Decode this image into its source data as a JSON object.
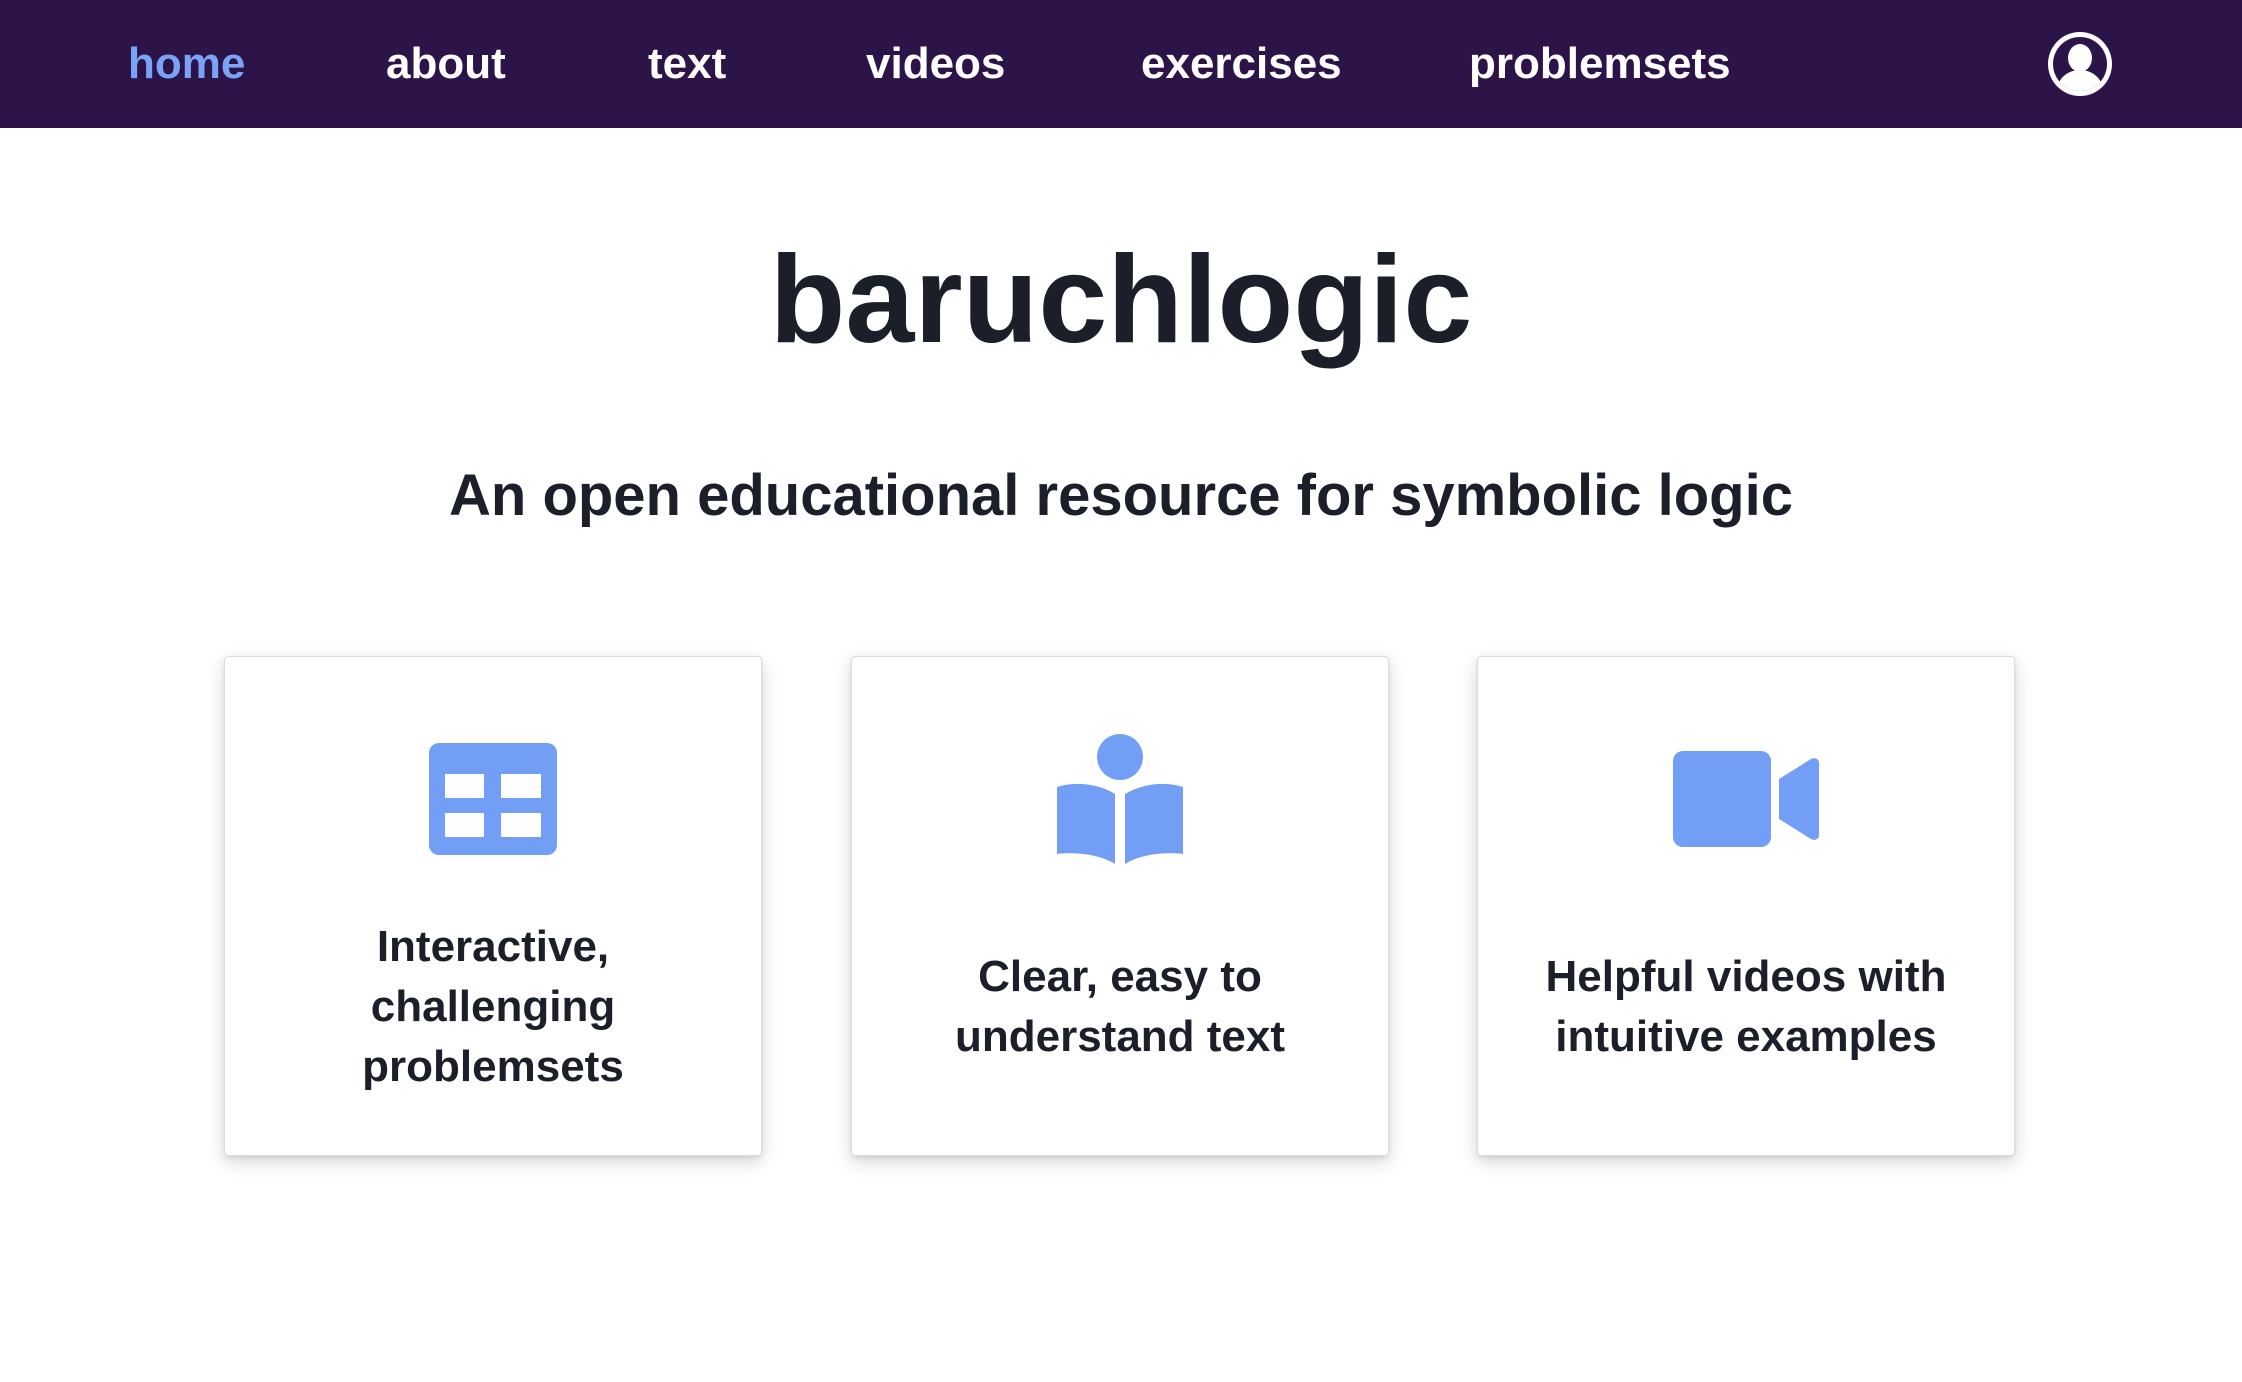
{
  "nav": {
    "links": [
      {
        "label": "home",
        "active": true
      },
      {
        "label": "about",
        "active": false
      },
      {
        "label": "text",
        "active": false
      },
      {
        "label": "videos",
        "active": false
      },
      {
        "label": "exercises",
        "active": false
      },
      {
        "label": "problemsets",
        "active": false
      }
    ],
    "user_icon": "user-circle-icon",
    "background_color": "#2c1449",
    "active_color": "#7aa2f7"
  },
  "hero": {
    "title": "baruchlogic",
    "subtitle": "An open educational resource for symbolic logic"
  },
  "features": [
    {
      "icon": "table-icon",
      "text": "Interactive, challenging problemsets"
    },
    {
      "icon": "reader-book-icon",
      "text": "Clear, easy to understand text"
    },
    {
      "icon": "video-camera-icon",
      "text": "Helpful videos with intuitive examples"
    }
  ],
  "icon_color": "#739ef5"
}
